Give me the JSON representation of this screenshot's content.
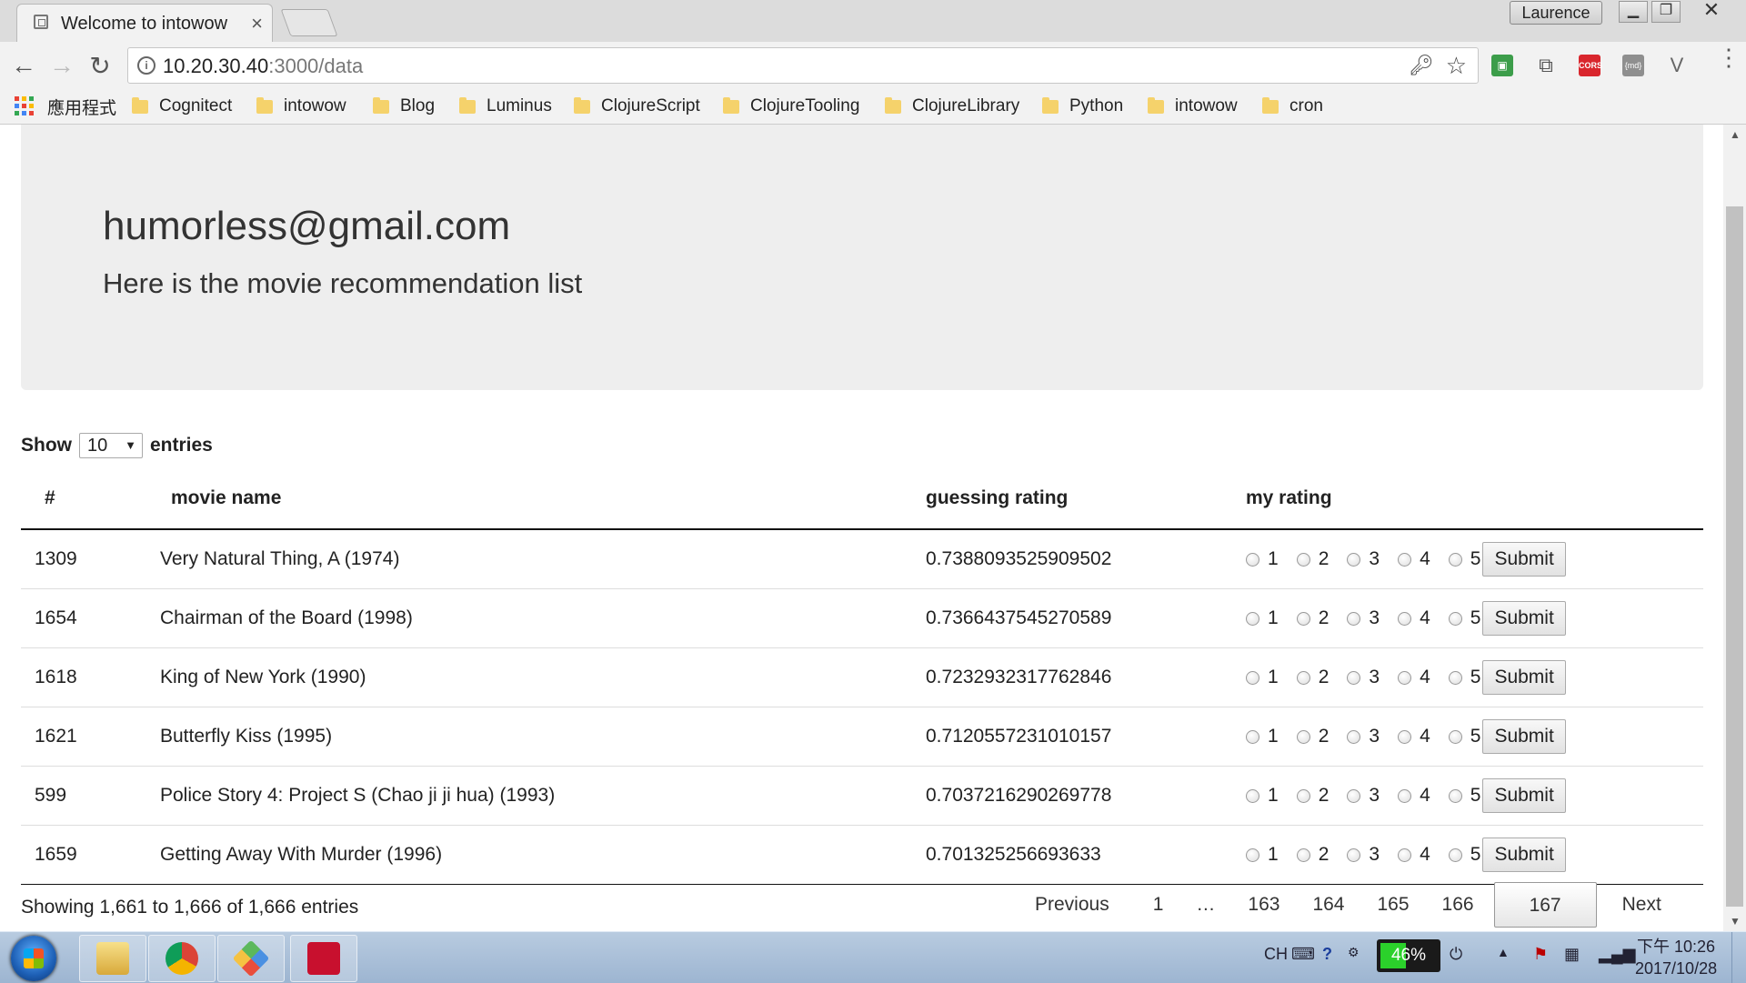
{
  "browser": {
    "tab_title": "Welcome to intowow",
    "tab_close": "×",
    "profile_name": "Laurence",
    "url_host": "10.20.30.40",
    "url_path": ":3000/data",
    "ext_cors_label": "CORS",
    "ext_json_label": "{md}",
    "bookmarks": {
      "apps_label": "應用程式",
      "items": [
        "Cognitect",
        "intowow",
        "Blog",
        "Luminus",
        "ClojureScript",
        "ClojureTooling",
        "ClojureLibrary",
        "Python",
        "intowow",
        "cron"
      ]
    }
  },
  "page": {
    "user_email": "humorless@gmail.com",
    "subtitle": "Here is the movie recommendation list",
    "length": {
      "show_label": "Show",
      "selected": "10",
      "entries_label": "entries"
    },
    "table": {
      "headers": {
        "num": "#",
        "movie": "movie name",
        "guess": "guessing rating",
        "mine": "my rating"
      },
      "rating_labels": [
        "1",
        "2",
        "3",
        "4",
        "5"
      ],
      "submit_label": "Submit",
      "rows": [
        {
          "id": "1309",
          "movie": "Very Natural Thing, A (1974)",
          "guess": "0.7388093525909502"
        },
        {
          "id": "1654",
          "movie": "Chairman of the Board (1998)",
          "guess": "0.7366437545270589"
        },
        {
          "id": "1618",
          "movie": "King of New York (1990)",
          "guess": "0.7232932317762846"
        },
        {
          "id": "1621",
          "movie": "Butterfly Kiss (1995)",
          "guess": "0.7120557231010157"
        },
        {
          "id": "599",
          "movie": "Police Story 4: Project S (Chao ji ji hua) (1993)",
          "guess": "0.7037216290269778"
        },
        {
          "id": "1659",
          "movie": "Getting Away With Murder (1996)",
          "guess": "0.701325256693633"
        }
      ]
    },
    "info": "Showing 1,661 to 1,666 of 1,666 entries",
    "pagination": {
      "previous": "Previous",
      "pages": [
        "1",
        "…",
        "163",
        "164",
        "165",
        "166"
      ],
      "current": "167",
      "next": "Next"
    }
  },
  "taskbar": {
    "ime": "CH",
    "battery": "46%",
    "time": "下午 10:26",
    "date": "2017/10/28"
  },
  "colors": {
    "jumbotron_bg": "#eeeeee",
    "header_rule": "#111111",
    "taskbar": "#a9c0da"
  }
}
